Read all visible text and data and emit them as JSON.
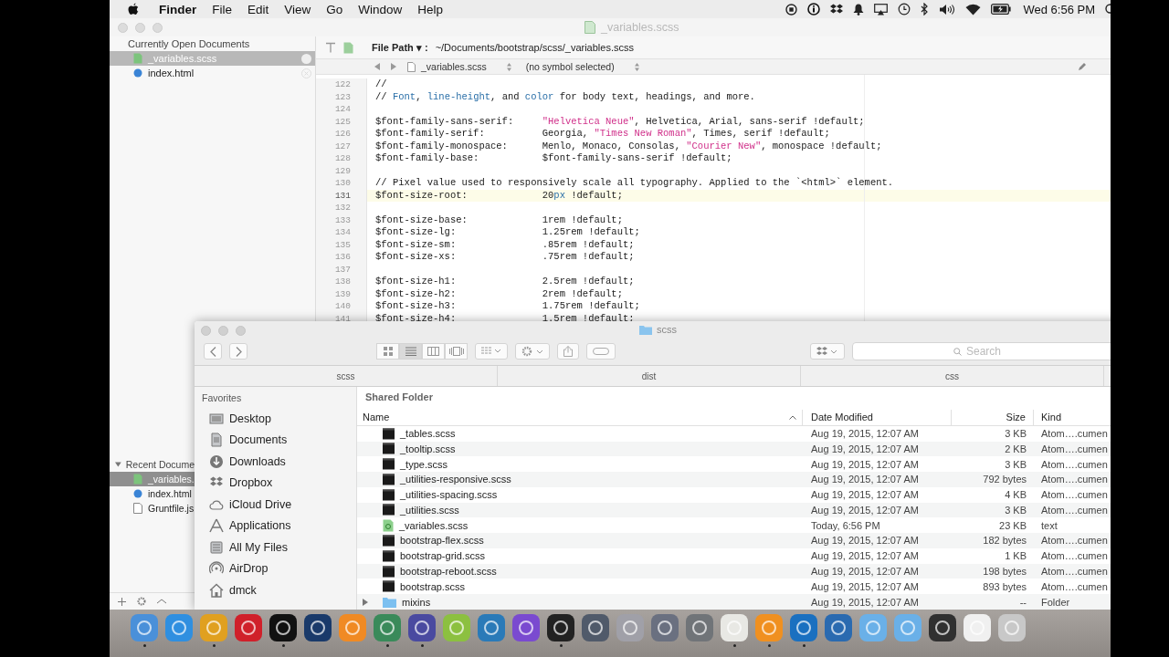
{
  "menu_bar": {
    "items": [
      "Finder",
      "File",
      "Edit",
      "View",
      "Go",
      "Window",
      "Help"
    ],
    "clock": "Wed 6:56 PM"
  },
  "editor": {
    "title": "_variables.scss",
    "open_header": "Currently Open Documents",
    "open_docs": [
      {
        "name": "_variables.scss",
        "kind": "scss",
        "selected": true
      },
      {
        "name": "index.html",
        "kind": "html",
        "selected": false
      }
    ],
    "recent_header": "Recent Docume",
    "recent_docs": [
      {
        "name": "_variables.",
        "kind": "scss",
        "selected": true
      },
      {
        "name": "index.html",
        "kind": "html",
        "selected": false
      },
      {
        "name": "Gruntfile.js",
        "kind": "js",
        "selected": false
      }
    ],
    "path_label": "File Path ▾ :",
    "path": "~/Documents/bootstrap/scss/_variables.scss",
    "nav_file": "_variables.scss",
    "nav_symbol": "(no symbol selected)",
    "lines": [
      {
        "n": "122",
        "current": false,
        "parts": [
          {
            "t": "//"
          }
        ]
      },
      {
        "n": "123",
        "current": false,
        "parts": [
          {
            "t": "// "
          },
          {
            "t": "Font",
            "keyword": true
          },
          {
            "t": ", "
          },
          {
            "t": "line-height",
            "keyword": true
          },
          {
            "t": ", and "
          },
          {
            "t": "color",
            "keyword": true
          },
          {
            "t": " for body text, headings, and more."
          }
        ]
      },
      {
        "n": "124",
        "current": false
      },
      {
        "n": "125",
        "current": false,
        "parts": [
          {
            "t": "$font-family-sans-serif:     "
          },
          {
            "t": "\"Helvetica Neue\"",
            "string": true
          },
          {
            "t": ", Helvetica, Arial, sans-serif !default;"
          }
        ]
      },
      {
        "n": "126",
        "current": false,
        "parts": [
          {
            "t": "$font-family-serif:          Georgia, "
          },
          {
            "t": "\"Times New Roman\"",
            "string": true
          },
          {
            "t": ", Times, serif !default;"
          }
        ]
      },
      {
        "n": "127",
        "current": false,
        "parts": [
          {
            "t": "$font-family-monospace:      Menlo, Monaco, Consolas, "
          },
          {
            "t": "\"Courier New\"",
            "string": true
          },
          {
            "t": ", monospace !default;"
          }
        ]
      },
      {
        "n": "128",
        "current": false,
        "parts": [
          {
            "t": "$font-family-base:           $font-family-sans-serif !default;"
          }
        ]
      },
      {
        "n": "129",
        "current": false
      },
      {
        "n": "130",
        "current": false,
        "parts": [
          {
            "t": "// Pixel value used to responsively scale all typography. Applied to the `<html>` element."
          }
        ]
      },
      {
        "n": "131",
        "current": true,
        "parts": [
          {
            "t": "$font-size-root:             20"
          },
          {
            "t": "px",
            "keyword": true
          },
          {
            "t": " !default;"
          }
        ]
      },
      {
        "n": "132",
        "current": false
      },
      {
        "n": "133",
        "current": false,
        "parts": [
          {
            "t": "$font-size-base:             1rem !default;"
          }
        ]
      },
      {
        "n": "134",
        "current": false,
        "parts": [
          {
            "t": "$font-size-lg:               1.25rem !default;"
          }
        ]
      },
      {
        "n": "135",
        "current": false,
        "parts": [
          {
            "t": "$font-size-sm:               .85rem !default;"
          }
        ]
      },
      {
        "n": "136",
        "current": false,
        "parts": [
          {
            "t": "$font-size-xs:               .75rem !default;"
          }
        ]
      },
      {
        "n": "137",
        "current": false
      },
      {
        "n": "138",
        "current": false,
        "parts": [
          {
            "t": "$font-size-h1:               2.5rem !default;"
          }
        ]
      },
      {
        "n": "139",
        "current": false,
        "parts": [
          {
            "t": "$font-size-h2:               2rem !default;"
          }
        ]
      },
      {
        "n": "140",
        "current": false,
        "parts": [
          {
            "t": "$font-size-h3:               1.75rem !default;"
          }
        ]
      },
      {
        "n": "141",
        "current": false,
        "parts": [
          {
            "t": "$font-size-h4:               1.5rem !default;"
          }
        ]
      }
    ]
  },
  "finder": {
    "title": "scss",
    "search_placeholder": "Search",
    "path_tabs": [
      "scss",
      "dist",
      "css"
    ],
    "favorites_header": "Favorites",
    "favorites": [
      {
        "name": "Desktop",
        "kind": "desktop"
      },
      {
        "name": "Documents",
        "kind": "documents"
      },
      {
        "name": "Downloads",
        "kind": "downloads"
      },
      {
        "name": "Dropbox",
        "kind": "dropbox"
      },
      {
        "name": "iCloud Drive",
        "kind": "cloud"
      },
      {
        "name": "Applications",
        "kind": "applications"
      },
      {
        "name": "All My Files",
        "kind": "files"
      },
      {
        "name": "AirDrop",
        "kind": "airdrop"
      },
      {
        "name": "dmck",
        "kind": "home"
      }
    ],
    "list_header": "Shared Folder",
    "columns": [
      "Name",
      "Date Modified",
      "Size",
      "Kind"
    ],
    "rows": [
      {
        "name": "_tables.scss",
        "date": "Aug 19, 2015, 12:07 AM",
        "size": "3 KB",
        "kind_text": "Atom….cumen",
        "kind": "file"
      },
      {
        "name": "_tooltip.scss",
        "date": "Aug 19, 2015, 12:07 AM",
        "size": "2 KB",
        "kind_text": "Atom….cumen",
        "kind": "file"
      },
      {
        "name": "_type.scss",
        "date": "Aug 19, 2015, 12:07 AM",
        "size": "3 KB",
        "kind_text": "Atom….cumen",
        "kind": "file"
      },
      {
        "name": "_utilities-responsive.scss",
        "date": "Aug 19, 2015, 12:07 AM",
        "size": "792 bytes",
        "kind_text": "Atom….cumen",
        "kind": "file"
      },
      {
        "name": "_utilities-spacing.scss",
        "date": "Aug 19, 2015, 12:07 AM",
        "size": "4 KB",
        "kind_text": "Atom….cumen",
        "kind": "file"
      },
      {
        "name": "_utilities.scss",
        "date": "Aug 19, 2015, 12:07 AM",
        "size": "3 KB",
        "kind_text": "Atom….cumen",
        "kind": "file"
      },
      {
        "name": "_variables.scss",
        "date": "Today, 6:56 PM",
        "size": "23 KB",
        "kind_text": "text",
        "kind": "atom"
      },
      {
        "name": "bootstrap-flex.scss",
        "date": "Aug 19, 2015, 12:07 AM",
        "size": "182 bytes",
        "kind_text": "Atom….cumen",
        "kind": "file"
      },
      {
        "name": "bootstrap-grid.scss",
        "date": "Aug 19, 2015, 12:07 AM",
        "size": "1 KB",
        "kind_text": "Atom….cumen",
        "kind": "file"
      },
      {
        "name": "bootstrap-reboot.scss",
        "date": "Aug 19, 2015, 12:07 AM",
        "size": "198 bytes",
        "kind_text": "Atom….cumen",
        "kind": "file"
      },
      {
        "name": "bootstrap.scss",
        "date": "Aug 19, 2015, 12:07 AM",
        "size": "893 bytes",
        "kind_text": "Atom….cumen",
        "kind": "file"
      },
      {
        "name": "mixins",
        "date": "Aug 19, 2015, 12:07 AM",
        "size": "--",
        "kind_text": "Folder",
        "kind": "folder"
      }
    ]
  },
  "dock": [
    {
      "color": "#4a90d9",
      "running": true
    },
    {
      "color": "#2f8fe0",
      "running": false
    },
    {
      "color": "#e0a020",
      "running": true
    },
    {
      "color": "#d0202a",
      "running": false
    },
    {
      "color": "#111111",
      "running": true
    },
    {
      "color": "#1a3a6a",
      "running": false
    },
    {
      "color": "#f08a24",
      "running": false
    },
    {
      "color": "#3a8a5a",
      "running": true
    },
    {
      "color": "#4a4aa0",
      "running": true
    },
    {
      "color": "#8cc040",
      "running": false
    },
    {
      "color": "#2a7ab8",
      "running": false
    },
    {
      "color": "#7a4ad0",
      "running": false
    },
    {
      "color": "#222222",
      "running": true
    },
    {
      "color": "#505a6a",
      "running": false
    },
    {
      "color": "#a0a0a8",
      "running": false
    },
    {
      "color": "#6a7080",
      "running": false
    },
    {
      "color": "#707478",
      "running": false
    },
    {
      "color": "#e8e8e4",
      "running": true
    },
    {
      "color": "#f09020",
      "running": true
    },
    {
      "color": "#1a70c0",
      "running": true
    },
    {
      "color": "#2a6ab0",
      "running": false
    },
    {
      "color": "#6ab0e8",
      "running": false
    },
    {
      "color": "#6ab0e8",
      "running": false
    },
    {
      "color": "#303030",
      "running": false
    },
    {
      "color": "#f0f0f0",
      "running": false
    },
    {
      "color": "#c8c8c8",
      "running": false
    }
  ]
}
